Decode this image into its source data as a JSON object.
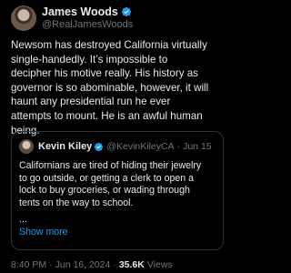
{
  "author": {
    "name": "James Woods",
    "handle": "@RealJamesWoods"
  },
  "post": {
    "lines": [
      "Newsom has destroyed California virtually",
      "single-handedly. It’s impossible to",
      "decipher his motive really. His history as",
      "governor is so abominable, however,  it will",
      "haunt any presidential run he ever",
      "attempts to mount. He is an awful human",
      "being."
    ]
  },
  "quote": {
    "name": "Kevin Kiley",
    "handle": "@KevinKileyCA",
    "separator": "·",
    "date": "Jun 15",
    "lines": [
      "Californians are tired of hiding their jewelry",
      "to go outside, or getting a clerk to open a",
      "lock to buy groceries, or wading through",
      "tents on the way to school."
    ],
    "ellipsis": "...",
    "show_more": "Show more"
  },
  "meta": {
    "time": "8:40 PM",
    "separator": "·",
    "date": "Jun 16, 2024",
    "views_count": "35.6K",
    "views_label": "Views"
  },
  "colors": {
    "background": "#000000",
    "text": "#e7e9ea",
    "secondary": "#71767b",
    "link": "#1d9bf0",
    "verified": "#1d9bf0",
    "border": "#2f3336"
  },
  "icons": {
    "verified": "verified-badge-icon"
  }
}
